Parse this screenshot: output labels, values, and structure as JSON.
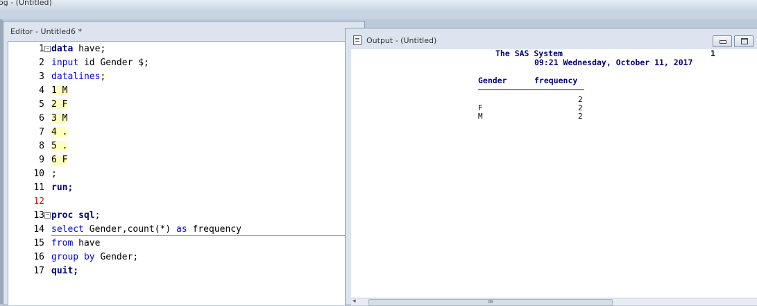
{
  "log_window": {
    "title": "og - (Untitled)"
  },
  "editor": {
    "title": "Editor - Untitled6 *",
    "lines": [
      {
        "n": "1",
        "fold": "⊟",
        "segments": [
          {
            "t": "data",
            "c": "kw-bold"
          },
          {
            "t": " have;",
            "c": ""
          }
        ]
      },
      {
        "n": "2",
        "segments": [
          {
            "t": "input",
            "c": "kw"
          },
          {
            "t": " id Gender $;",
            "c": ""
          }
        ]
      },
      {
        "n": "3",
        "segments": [
          {
            "t": "datalines",
            "c": "kw"
          },
          {
            "t": ";",
            "c": ""
          }
        ]
      },
      {
        "n": "4",
        "segments": [
          {
            "t": "1 M",
            "c": "dl-hl"
          }
        ]
      },
      {
        "n": "5",
        "segments": [
          {
            "t": "2 F",
            "c": "dl-hl"
          }
        ]
      },
      {
        "n": "6",
        "segments": [
          {
            "t": "3 M",
            "c": "dl-hl"
          }
        ]
      },
      {
        "n": "7",
        "segments": [
          {
            "t": "4 .",
            "c": "dl-hl"
          }
        ]
      },
      {
        "n": "8",
        "segments": [
          {
            "t": "5 .",
            "c": "dl-hl"
          }
        ]
      },
      {
        "n": "9",
        "segments": [
          {
            "t": "6 F",
            "c": "dl-hl"
          }
        ]
      },
      {
        "n": "10",
        "segments": [
          {
            "t": ";",
            "c": ""
          }
        ]
      },
      {
        "n": "11",
        "segments": [
          {
            "t": "run;",
            "c": "kw-bold"
          }
        ]
      },
      {
        "n": "12",
        "red": true,
        "segments": []
      },
      {
        "n": "13",
        "fold": "⊟",
        "segments": [
          {
            "t": "proc sql",
            "c": "kw-bold"
          },
          {
            "t": ";",
            "c": ""
          }
        ]
      },
      {
        "n": "14",
        "segments": [
          {
            "t": "select",
            "c": "kw"
          },
          {
            "t": " Gender,count(*) ",
            "c": ""
          },
          {
            "t": "as",
            "c": "kw"
          },
          {
            "t": " frequency",
            "c": ""
          }
        ]
      },
      {
        "n": "15",
        "segments": [
          {
            "t": "from",
            "c": "kw"
          },
          {
            "t": " have",
            "c": ""
          }
        ]
      },
      {
        "n": "16",
        "segments": [
          {
            "t": "group by",
            "c": "kw"
          },
          {
            "t": " Gender;",
            "c": ""
          }
        ]
      },
      {
        "n": "17",
        "segments": [
          {
            "t": "quit;",
            "c": "kw-bold"
          }
        ]
      }
    ]
  },
  "output": {
    "title": "Output - (Untitled)",
    "header_line1": "The SAS System",
    "page_number": "1",
    "header_line2": "09:21 Wednesday, October 11, 2017",
    "table": {
      "columns": [
        "Gender",
        "frequency"
      ],
      "rows": [
        {
          "gender": "",
          "frequency": "2"
        },
        {
          "gender": "F",
          "frequency": "2"
        },
        {
          "gender": "M",
          "frequency": "2"
        }
      ]
    },
    "scroll_thumb_label": "III"
  }
}
